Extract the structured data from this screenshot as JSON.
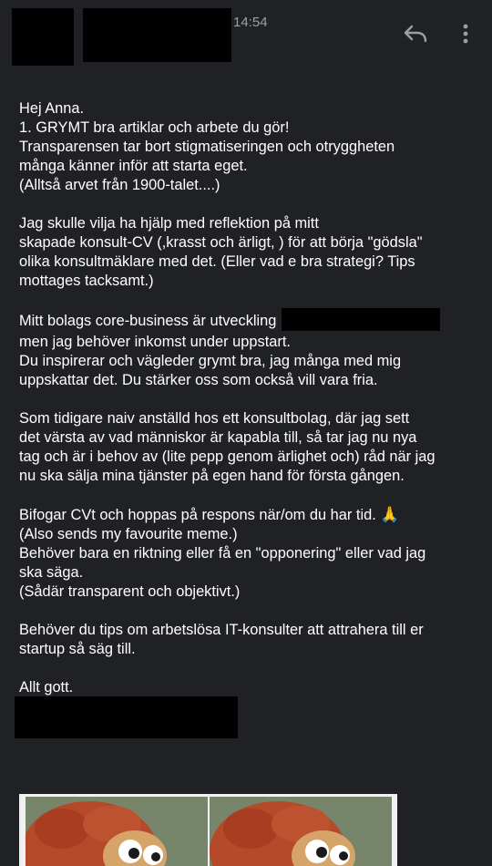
{
  "header": {
    "time": "14:54",
    "reply_icon": "reply-icon",
    "more_icon": "more-vertical-icon"
  },
  "email": {
    "p1": [
      "Hej Anna.",
      "1. GRYMT bra artiklar och arbete du gör!",
      "Transparensen tar bort stigmatiseringen och otryggheten",
      "många känner inför att starta eget.",
      "(Alltså arvet från 1900-talet....)"
    ],
    "p2": [
      "Jag skulle vilja ha hjälp med reflektion på mitt",
      "skapade konsult-CV (,krasst och ärligt, ) för att börja \"gödsla\"",
      "olika konsultmäklare med det. (Eller vad e bra strategi? Tips",
      "mottages tacksamt.)"
    ],
    "p3": [
      "Mitt bolags core-business är utveckling",
      "men jag behöver inkomst under uppstart.",
      "Du inspirerar och vägleder grymt bra, jag många med mig",
      "uppskattar det. Du stärker oss som också vill vara fria."
    ],
    "p4": [
      "Som tidigare naiv anställd hos ett konsultbolag, där jag sett",
      "det värsta av vad människor är kapabla till, så tar jag nu nya",
      "tag och är i behov av (lite pepp genom ärlighet och) råd när jag",
      "nu ska sälja mina tjänster på egen hand för första gången."
    ],
    "p5_first": "Bifogar CVt och hoppas på respons när/om du har tid.",
    "p5_emoji": "🙏",
    "p5": [
      "(Also sends my favourite meme.)",
      "Behöver bara en riktning eller få en \"opponering\" eller vad jag",
      "ska säga.",
      "(Sådär transparent och objektivt.)"
    ],
    "p6": [
      "Behöver du tips om arbetslösa IT-konsulter att attrahera till er",
      "startup så säg till."
    ],
    "closing": "Allt gott."
  },
  "colors": {
    "background": "#202124",
    "text": "#ffffff",
    "secondary_text": "#9aa0a6",
    "redaction": "#000000"
  }
}
